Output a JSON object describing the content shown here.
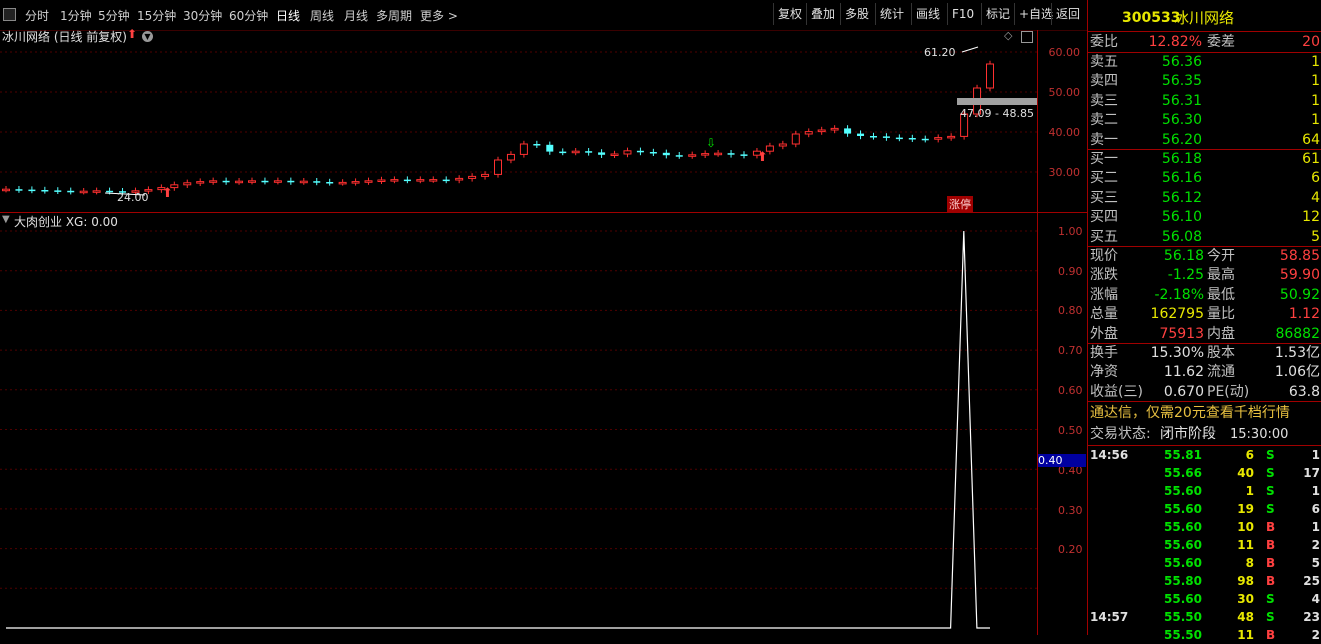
{
  "toolbar": {
    "periods": [
      "分时",
      "1分钟",
      "5分钟",
      "15分钟",
      "30分钟",
      "60分钟",
      "日线",
      "周线",
      "月线",
      "多周期",
      "更多 >"
    ],
    "tools": [
      "复权",
      "叠加",
      "多股",
      "统计",
      "画线",
      "F10",
      "标记",
      "+自选",
      "返回"
    ]
  },
  "chart_header": {
    "title": "冰川网络 (日线 前复权)",
    "high_label": "61.20",
    "low_label": "24.00",
    "range_label": "47.09 - 48.85",
    "badge": "涨停",
    "yaxis": [
      "60.00",
      "50.00",
      "40.00",
      "30.00"
    ]
  },
  "indicator": {
    "title": "大肉创业  XG: 0.00",
    "yaxis": [
      "1.00",
      "0.90",
      "0.80",
      "0.70",
      "0.60",
      "0.50",
      "0.40",
      "0.30",
      "0.20"
    ],
    "cursor_value": "0.40"
  },
  "chart_data": {
    "type": "line",
    "title": "大肉创业  XG: 0.00",
    "ylim": [
      0,
      1.05
    ],
    "x": [
      0,
      1,
      2,
      3,
      4,
      5,
      6,
      7,
      8,
      9,
      10,
      11,
      12,
      13,
      14,
      15,
      16,
      17,
      18,
      19,
      20,
      21,
      22,
      23,
      24,
      25,
      26,
      27,
      28,
      29,
      30,
      31,
      32,
      33,
      34,
      35,
      36,
      37,
      38,
      39,
      40,
      41,
      42,
      43,
      44,
      45,
      46,
      47,
      48,
      49,
      50,
      51,
      52,
      53,
      54,
      55,
      56,
      57,
      58,
      59,
      60,
      61,
      62,
      63,
      64,
      65,
      66,
      67,
      68,
      69,
      70,
      71,
      72,
      73,
      74,
      75
    ],
    "series": [
      {
        "values": [
          0,
          0,
          0,
          0,
          0,
          0,
          0,
          0,
          0,
          0,
          0,
          0,
          0,
          0,
          0,
          0,
          0,
          0,
          0,
          0,
          0,
          0,
          0,
          0,
          0,
          0,
          0,
          0,
          0,
          0,
          0,
          0,
          0,
          0,
          0,
          0,
          0,
          0,
          0,
          0,
          0,
          0,
          0,
          0,
          0,
          0,
          0,
          0,
          0,
          0,
          0,
          0,
          0,
          0,
          0,
          0,
          0,
          0,
          0,
          0,
          0,
          0,
          0,
          0,
          0,
          0,
          0,
          0,
          0,
          0,
          0,
          0,
          0,
          1,
          0,
          0
        ]
      }
    ]
  },
  "panel": {
    "code": "300533",
    "name": "冰川网络",
    "weibi": {
      "label": "委比",
      "value": "12.82%",
      "label2": "委差",
      "value2": "20"
    },
    "sell": [
      {
        "label": "卖五",
        "price": "56.36",
        "qty": "1"
      },
      {
        "label": "卖四",
        "price": "56.35",
        "qty": "1"
      },
      {
        "label": "卖三",
        "price": "56.31",
        "qty": "1"
      },
      {
        "label": "卖二",
        "price": "56.30",
        "qty": "1"
      },
      {
        "label": "卖一",
        "price": "56.20",
        "qty": "64"
      }
    ],
    "buy": [
      {
        "label": "买一",
        "price": "56.18",
        "qty": "61"
      },
      {
        "label": "买二",
        "price": "56.16",
        "qty": "6"
      },
      {
        "label": "买三",
        "price": "56.12",
        "qty": "4"
      },
      {
        "label": "买四",
        "price": "56.10",
        "qty": "12"
      },
      {
        "label": "买五",
        "price": "56.08",
        "qty": "5"
      }
    ],
    "quote": [
      {
        "l1": "现价",
        "v1": "56.18",
        "l2": "今开",
        "v2": "58.85"
      },
      {
        "l1": "涨跌",
        "v1": "-1.25",
        "l2": "最高",
        "v2": "59.90"
      },
      {
        "l1": "涨幅",
        "v1": "-2.18%",
        "l2": "最低",
        "v2": "50.92"
      },
      {
        "l1": "总量",
        "v1": "162795",
        "l2": "量比",
        "v2": "1.12"
      },
      {
        "l1": "外盘",
        "v1": "75913",
        "l2": "内盘",
        "v2": "86882"
      }
    ],
    "fund": [
      {
        "l1": "换手",
        "v1": "15.30%",
        "l2": "股本",
        "v2": "1.53亿"
      },
      {
        "l1": "净资",
        "v1": "11.62",
        "l2": "流通",
        "v2": "1.06亿"
      },
      {
        "l1": "收益(三)",
        "v1": "0.670",
        "l2": "PE(动)",
        "v2": "63.8"
      }
    ],
    "ad_text": "通达信，仅需20元查看千档行情",
    "status_label": "交易状态:",
    "status_value": "闭市阶段",
    "status_time": "15:30:00",
    "ticks": [
      {
        "time": "14:56",
        "price": "55.81",
        "vol": "6",
        "side": "S",
        "n": "1"
      },
      {
        "time": "",
        "price": "55.66",
        "vol": "40",
        "side": "S",
        "n": "17"
      },
      {
        "time": "",
        "price": "55.60",
        "vol": "1",
        "side": "S",
        "n": "1"
      },
      {
        "time": "",
        "price": "55.60",
        "vol": "19",
        "side": "S",
        "n": "6"
      },
      {
        "time": "",
        "price": "55.60",
        "vol": "10",
        "side": "B",
        "n": "1"
      },
      {
        "time": "",
        "price": "55.60",
        "vol": "11",
        "side": "B",
        "n": "2"
      },
      {
        "time": "",
        "price": "55.60",
        "vol": "8",
        "side": "B",
        "n": "5"
      },
      {
        "time": "",
        "price": "55.80",
        "vol": "98",
        "side": "B",
        "n": "25"
      },
      {
        "time": "",
        "price": "55.60",
        "vol": "30",
        "side": "S",
        "n": "4"
      },
      {
        "time": "14:57",
        "price": "55.50",
        "vol": "48",
        "side": "S",
        "n": "23"
      },
      {
        "time": "",
        "price": "55.50",
        "vol": "11",
        "side": "B",
        "n": "2"
      }
    ]
  }
}
